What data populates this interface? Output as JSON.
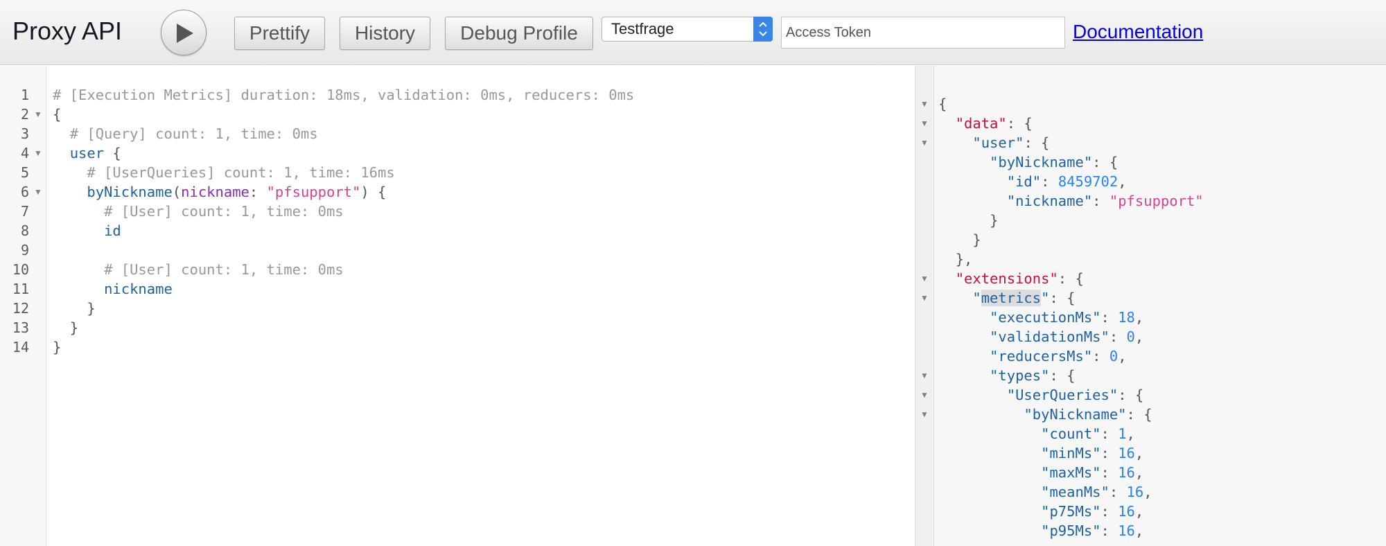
{
  "app": {
    "title": "Proxy API"
  },
  "toolbar": {
    "run_icon": "play-icon",
    "prettify_label": "Prettify",
    "history_label": "History",
    "debug_label": "Debug Profile",
    "select_value": "Testfrage",
    "token_placeholder": "Access Token",
    "documentation_label": "Documentation"
  },
  "query_editor": {
    "line_numbers": [
      "1",
      "2",
      "3",
      "4",
      "5",
      "6",
      "7",
      "8",
      "9",
      "10",
      "11",
      "12",
      "13",
      "14"
    ],
    "lines": [
      {
        "parts": [
          [
            "c",
            "# [Execution Metrics] duration: 18ms, validation: 0ms, reducers: 0ms"
          ]
        ]
      },
      {
        "parts": [
          [
            "p",
            "{"
          ]
        ]
      },
      {
        "parts": [
          [
            "s",
            "  "
          ],
          [
            "c",
            "# [Query] count: 1, time: 0ms"
          ]
        ]
      },
      {
        "parts": [
          [
            "s",
            "  "
          ],
          [
            "f",
            "user"
          ],
          [
            "p",
            " {"
          ]
        ]
      },
      {
        "parts": [
          [
            "s",
            "    "
          ],
          [
            "c",
            "# [UserQueries] count: 1, time: 16ms"
          ]
        ]
      },
      {
        "parts": [
          [
            "s",
            "    "
          ],
          [
            "f",
            "byNickname"
          ],
          [
            "p",
            "("
          ],
          [
            "a",
            "nickname"
          ],
          [
            "p",
            ": "
          ],
          [
            "st",
            "\"pfsupport\""
          ],
          [
            "p",
            ") {"
          ]
        ]
      },
      {
        "parts": [
          [
            "s",
            "      "
          ],
          [
            "c",
            "# [User] count: 1, time: 0ms"
          ]
        ]
      },
      {
        "parts": [
          [
            "s",
            "      "
          ],
          [
            "f",
            "id"
          ]
        ]
      },
      {
        "parts": []
      },
      {
        "parts": [
          [
            "s",
            "      "
          ],
          [
            "c",
            "# [User] count: 1, time: 0ms"
          ]
        ]
      },
      {
        "parts": [
          [
            "s",
            "      "
          ],
          [
            "f",
            "nickname"
          ]
        ]
      },
      {
        "parts": [
          [
            "s",
            "    "
          ],
          [
            "p",
            "}"
          ]
        ]
      },
      {
        "parts": [
          [
            "s",
            "  "
          ],
          [
            "p",
            "}"
          ]
        ]
      },
      {
        "parts": [
          [
            "p",
            "}"
          ]
        ]
      }
    ]
  },
  "result_viewer": {
    "lines": [
      {
        "parts": [
          [
            "p",
            "{"
          ]
        ]
      },
      {
        "parts": [
          [
            "s",
            "  "
          ],
          [
            "r",
            "\"data\""
          ],
          [
            "p",
            ": {"
          ]
        ]
      },
      {
        "parts": [
          [
            "s",
            "    "
          ],
          [
            "k",
            "\"user\""
          ],
          [
            "p",
            ": {"
          ]
        ]
      },
      {
        "parts": [
          [
            "s",
            "      "
          ],
          [
            "k",
            "\"byNickname\""
          ],
          [
            "p",
            ": {"
          ]
        ]
      },
      {
        "parts": [
          [
            "s",
            "        "
          ],
          [
            "k",
            "\"id\""
          ],
          [
            "p",
            ": "
          ],
          [
            "n",
            "8459702"
          ],
          [
            "p",
            ","
          ]
        ]
      },
      {
        "parts": [
          [
            "s",
            "        "
          ],
          [
            "k",
            "\"nickname\""
          ],
          [
            "p",
            ": "
          ],
          [
            "st",
            "\"pfsupport\""
          ]
        ]
      },
      {
        "parts": [
          [
            "s",
            "      "
          ],
          [
            "p",
            "}"
          ]
        ]
      },
      {
        "parts": [
          [
            "s",
            "    "
          ],
          [
            "p",
            "}"
          ]
        ]
      },
      {
        "parts": [
          [
            "s",
            "  "
          ],
          [
            "p",
            "},"
          ]
        ]
      },
      {
        "parts": [
          [
            "s",
            "  "
          ],
          [
            "r",
            "\"extensions\""
          ],
          [
            "p",
            ": {"
          ]
        ]
      },
      {
        "parts": [
          [
            "s",
            "    "
          ],
          [
            "k",
            "\""
          ],
          [
            "kh",
            "metrics"
          ],
          [
            "k",
            "\""
          ],
          [
            "p",
            ": {"
          ]
        ]
      },
      {
        "parts": [
          [
            "s",
            "      "
          ],
          [
            "k",
            "\"executionMs\""
          ],
          [
            "p",
            ": "
          ],
          [
            "n",
            "18"
          ],
          [
            "p",
            ","
          ]
        ]
      },
      {
        "parts": [
          [
            "s",
            "      "
          ],
          [
            "k",
            "\"validationMs\""
          ],
          [
            "p",
            ": "
          ],
          [
            "n",
            "0"
          ],
          [
            "p",
            ","
          ]
        ]
      },
      {
        "parts": [
          [
            "s",
            "      "
          ],
          [
            "k",
            "\"reducersMs\""
          ],
          [
            "p",
            ": "
          ],
          [
            "n",
            "0"
          ],
          [
            "p",
            ","
          ]
        ]
      },
      {
        "parts": [
          [
            "s",
            "      "
          ],
          [
            "k",
            "\"types\""
          ],
          [
            "p",
            ": {"
          ]
        ]
      },
      {
        "parts": [
          [
            "s",
            "        "
          ],
          [
            "k",
            "\"UserQueries\""
          ],
          [
            "p",
            ": {"
          ]
        ]
      },
      {
        "parts": [
          [
            "s",
            "          "
          ],
          [
            "k",
            "\"byNickname\""
          ],
          [
            "p",
            ": {"
          ]
        ]
      },
      {
        "parts": [
          [
            "s",
            "            "
          ],
          [
            "k",
            "\"count\""
          ],
          [
            "p",
            ": "
          ],
          [
            "n",
            "1"
          ],
          [
            "p",
            ","
          ]
        ]
      },
      {
        "parts": [
          [
            "s",
            "            "
          ],
          [
            "k",
            "\"minMs\""
          ],
          [
            "p",
            ": "
          ],
          [
            "n",
            "16"
          ],
          [
            "p",
            ","
          ]
        ]
      },
      {
        "parts": [
          [
            "s",
            "            "
          ],
          [
            "k",
            "\"maxMs\""
          ],
          [
            "p",
            ": "
          ],
          [
            "n",
            "16"
          ],
          [
            "p",
            ","
          ]
        ]
      },
      {
        "parts": [
          [
            "s",
            "            "
          ],
          [
            "k",
            "\"meanMs\""
          ],
          [
            "p",
            ": "
          ],
          [
            "n",
            "16"
          ],
          [
            "p",
            ","
          ]
        ]
      },
      {
        "parts": [
          [
            "s",
            "            "
          ],
          [
            "k",
            "\"p75Ms\""
          ],
          [
            "p",
            ": "
          ],
          [
            "n",
            "16"
          ],
          [
            "p",
            ","
          ]
        ]
      },
      {
        "parts": [
          [
            "s",
            "            "
          ],
          [
            "k",
            "\"p95Ms\""
          ],
          [
            "p",
            ": "
          ],
          [
            "n",
            "16"
          ],
          [
            "p",
            ","
          ]
        ]
      }
    ]
  },
  "colors": {
    "comment": "#999999",
    "field": "#1f61a0",
    "argument": "#8b2bb9",
    "string": "#d64292",
    "number": "#2882f9",
    "root_key": "#c8103a",
    "link": "#0000ee"
  }
}
